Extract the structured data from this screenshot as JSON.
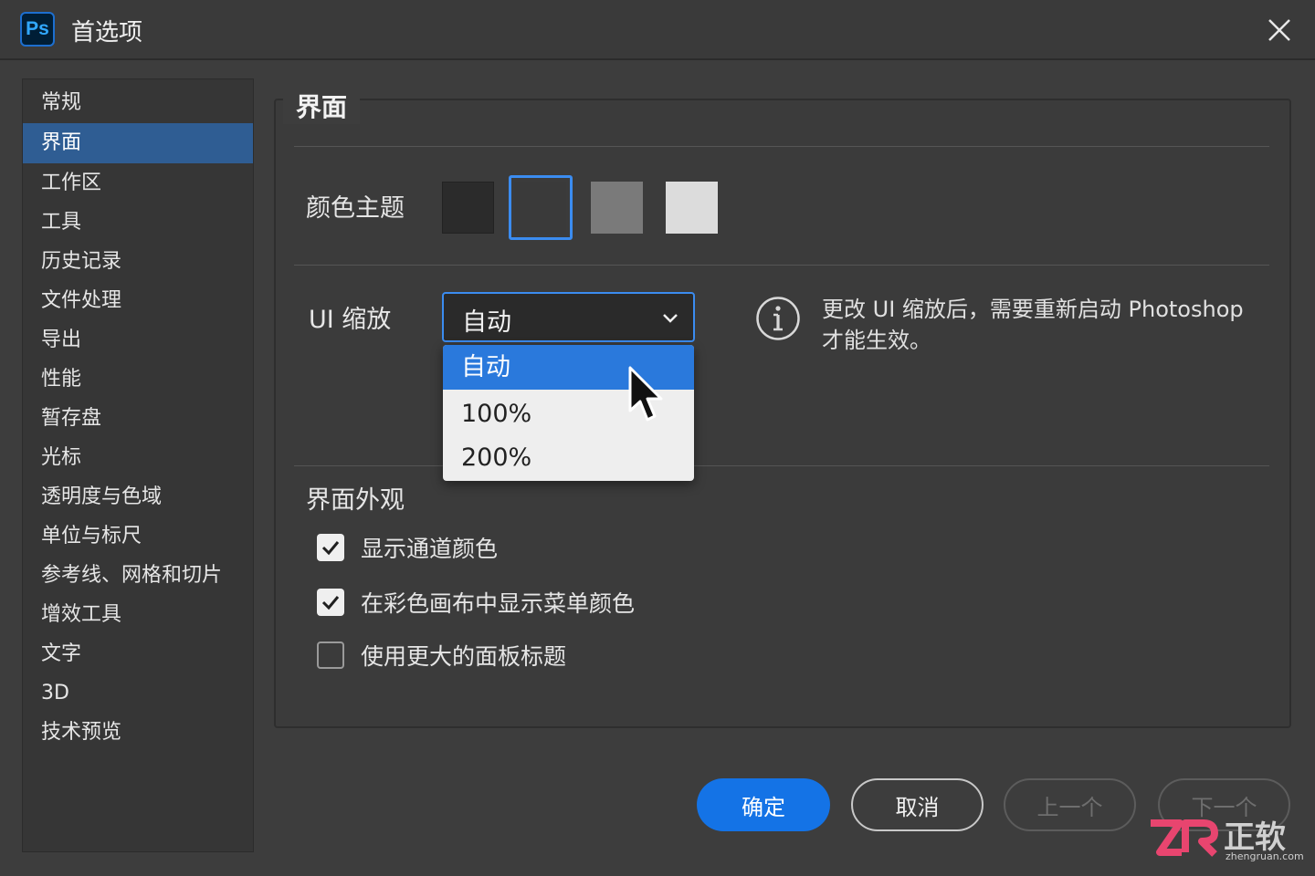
{
  "window": {
    "app_badge": "Ps",
    "title": "首选项"
  },
  "sidebar": {
    "items": [
      {
        "label": "常规"
      },
      {
        "label": "界面"
      },
      {
        "label": "工作区"
      },
      {
        "label": "工具"
      },
      {
        "label": "历史记录"
      },
      {
        "label": "文件处理"
      },
      {
        "label": "导出"
      },
      {
        "label": "性能"
      },
      {
        "label": "暂存盘"
      },
      {
        "label": "光标"
      },
      {
        "label": "透明度与色域"
      },
      {
        "label": "单位与标尺"
      },
      {
        "label": "参考线、网格和切片"
      },
      {
        "label": "增效工具"
      },
      {
        "label": "文字"
      },
      {
        "label": "3D"
      },
      {
        "label": "技术预览"
      }
    ],
    "active": "界面"
  },
  "panel": {
    "title": "界面",
    "color_theme": {
      "label": "颜色主题",
      "swatches": [
        "#2b2b2b",
        "#3a3a3a",
        "#7a7a7a",
        "#dcdcdc"
      ],
      "selected": 1
    },
    "ui_scale": {
      "label": "UI 缩放",
      "value": "自动",
      "options": [
        "自动",
        "100%",
        "200%"
      ],
      "highlighted": "自动"
    },
    "info_text": "更改 UI 缩放后，需要重新启动 Photoshop 才能生效。",
    "appearance": {
      "label": "界面外观",
      "checkboxes": [
        {
          "label": "显示通道颜色",
          "checked": true
        },
        {
          "label": "在彩色画布中显示菜单颜色",
          "checked": true
        },
        {
          "label": "使用更大的面板标题",
          "checked": false
        }
      ]
    }
  },
  "buttons": {
    "ok": "确定",
    "cancel": "取消",
    "prev": "上一个",
    "next": "下一个"
  },
  "watermark": {
    "text": "正软",
    "url_text": "zhengruan.com"
  },
  "colors": {
    "accent": "#1473e6",
    "selection": "#2f5d93",
    "background": "#3d3d3d"
  }
}
